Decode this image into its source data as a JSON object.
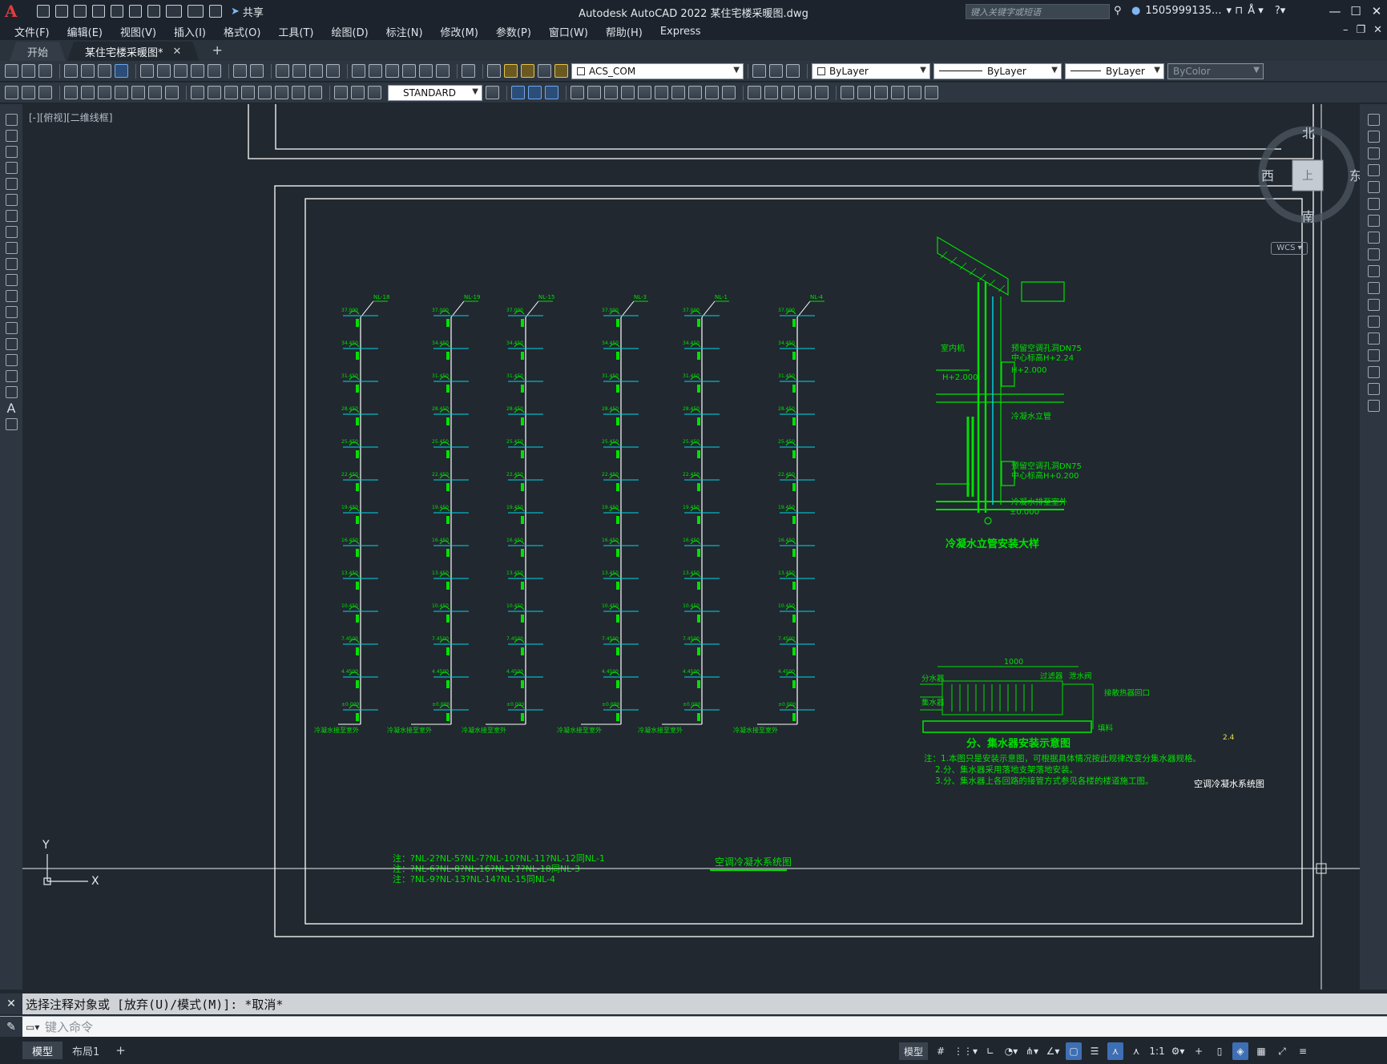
{
  "app": {
    "title": "Autodesk AutoCAD 2022    某住宅楼采暖图.dwg",
    "logo": "A",
    "share_label": "共享",
    "search_placeholder": "键入关键字或短语",
    "user": "1505999135...",
    "icons": [
      "new-icon",
      "open-icon",
      "save-icon",
      "saveas-icon",
      "plot-icon",
      "undo-icon",
      "redo-icon",
      "share-icon",
      "search-icon",
      "user-icon",
      "cart-icon",
      "help-icon"
    ]
  },
  "menu": [
    "文件(F)",
    "编辑(E)",
    "视图(V)",
    "插入(I)",
    "格式(O)",
    "工具(T)",
    "绘图(D)",
    "标注(N)",
    "修改(M)",
    "参数(P)",
    "窗口(W)",
    "帮助(H)",
    "Express"
  ],
  "tabs": [
    {
      "label": "开始",
      "active": false
    },
    {
      "label": "某住宅楼采暖图*",
      "active": true
    }
  ],
  "toolbar": {
    "layer": "ACS_COM",
    "color": "ByLayer",
    "linetype": "ByLayer",
    "lineweight": "ByLayer",
    "plotstyle": "ByColor",
    "textstyle": "STANDARD"
  },
  "viewport": {
    "label": "[-][俯视][二维线框]",
    "compass": {
      "n": "北",
      "s": "南",
      "e": "东",
      "w": "西",
      "center": "上"
    },
    "wcs": "WCS",
    "ucs": {
      "x": "X",
      "y": "Y"
    }
  },
  "drawing": {
    "colors": {
      "line": "#00e000",
      "frame": "#ffffff",
      "cyan": "#00d9e6",
      "bg": "#212830"
    },
    "risers": [
      {
        "tag": "NL-18",
        "base": "冷凝水接至室外"
      },
      {
        "tag": "NL-19",
        "base": "冷凝水接至室外"
      },
      {
        "tag": "NL-15",
        "base": "冷凝水接至室外"
      },
      {
        "tag": "NL-3",
        "base": "冷凝水接至室外"
      },
      {
        "tag": "NL-1",
        "base": "冷凝水接至室外"
      },
      {
        "tag": "NL-4",
        "base": "冷凝水接至室外"
      }
    ],
    "levels": [
      "37.000",
      "34.450",
      "31.450",
      "28.450",
      "25.450",
      "22.450",
      "19.450",
      "16.450",
      "13.450",
      "10.450",
      "7.4500",
      "4.4500",
      "±0.000"
    ],
    "notes_left": [
      "注：?NL-2?NL-5?NL-7?NL-10?NL-11?NL-12同NL-1",
      "注：?NL-6?NL-8?NL-16?NL-17?NL-18同NL-3",
      "注：?NL-9?NL-13?NL-14?NL-15同NL-4"
    ],
    "main_title": "空调冷凝水系统图",
    "detail_title": "冷凝水立管安装大样",
    "detail_labels": [
      "预留空调孔洞DN75",
      "中心标高H+2.24",
      "室内机",
      "H+2.000",
      "冷凝水立管",
      "预留空调孔洞DN75",
      "中心标高H+0.200",
      "冷凝水排至室外",
      "H+2.000",
      "±0.000"
    ],
    "manifold_title": "分、集水器安装示意图",
    "manifold_labels": [
      "分水器",
      "集水器",
      "过滤器",
      "泄水阀",
      "接散热器回口",
      "填料"
    ],
    "manifold_dim": "1000",
    "notes_right": [
      "注：1.本图只是安装示意图，可根据具体情况按此规律改变分集水器规格。",
      "2.分、集水器采用落地支架落地安装。",
      "3.分、集水器上各回路的接管方式参见各楼的楼道施工图。"
    ],
    "right_small_label": "2.4",
    "right_title": "空调冷凝水系统图"
  },
  "command": {
    "history": "选择注释对象或 [放弃(U)/模式(M)]: *取消*",
    "placeholder": "键入命令",
    "close": "✕",
    "wrench": "✎"
  },
  "status": {
    "layout_tabs": [
      {
        "label": "模型",
        "active": true
      },
      {
        "label": "布局1",
        "active": false
      }
    ],
    "model_label": "模型",
    "scale": "1:1",
    "buttons": [
      "grid-icon",
      "snap-icon",
      "ortho-icon",
      "polar-icon",
      "isodraft-icon",
      "osnap-icon",
      "lineweight-icon",
      "transparency-icon",
      "annotation-icon",
      "annoscale-icon",
      "workspace-icon",
      "plus-icon",
      "units-icon",
      "isolate-icon",
      "hardware-icon",
      "fullscreen-icon",
      "customize-icon"
    ]
  }
}
